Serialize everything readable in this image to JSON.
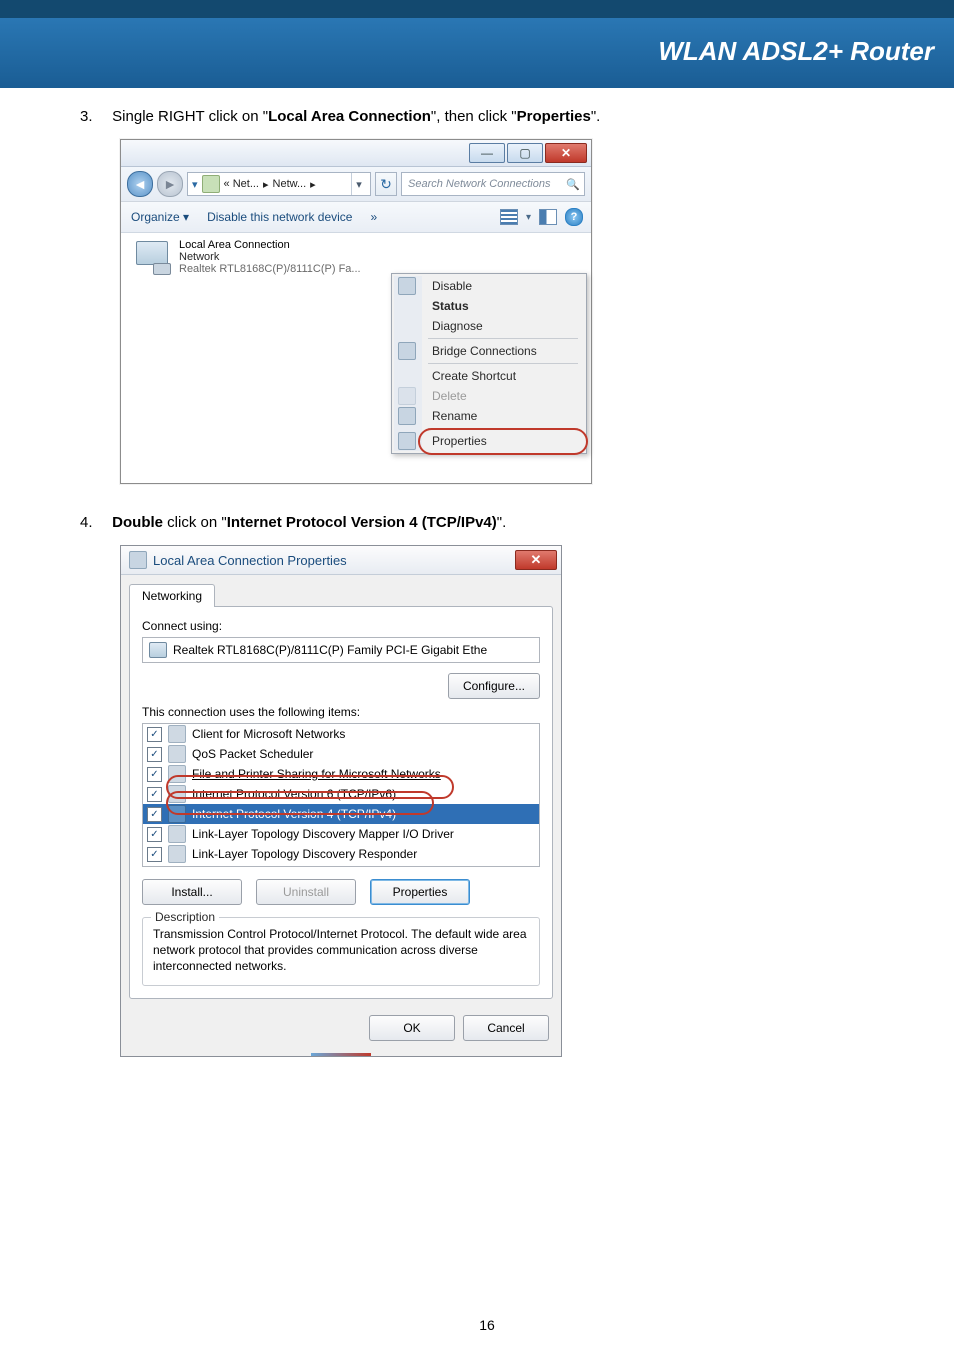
{
  "header": {
    "title": "WLAN ADSL2+ Router"
  },
  "steps": {
    "s3": {
      "num": "3.",
      "pre": "Single RIGHT click on \"",
      "bold1": "Local Area Connection",
      "mid": "\", then click \"",
      "bold2": "Properties",
      "post": "\"."
    },
    "s4": {
      "num": "4.",
      "boldA": "Double",
      "txt1": " click on \"",
      "boldB": "Internet Protocol Version 4 (TCP/IPv4)",
      "txt2": "\"."
    }
  },
  "win1": {
    "addr_part1": "«  Net...",
    "addr_sep": "▸",
    "addr_part2": "Netw...",
    "addr_sep2": "▸",
    "search_placeholder": "Search Network Connections",
    "toolbar": {
      "organize": "Organize ▾",
      "disable": "Disable this network device",
      "more": "»"
    },
    "conn": {
      "title": "Local Area Connection",
      "line2": "Network",
      "line3": "Realtek RTL8168C(P)/8111C(P) Fa..."
    },
    "menu": {
      "disable": "Disable",
      "status": "Status",
      "diagnose": "Diagnose",
      "bridge": "Bridge Connections",
      "shortcut": "Create Shortcut",
      "delete": "Delete",
      "rename": "Rename",
      "properties": "Properties"
    }
  },
  "dlg": {
    "title": "Local Area Connection Properties",
    "tab": "Networking",
    "connect_using": "Connect using:",
    "adapter": "Realtek RTL8168C(P)/8111C(P) Family PCI-E Gigabit Ethe",
    "configure": "Configure...",
    "uses": "This connection uses the following items:",
    "items": [
      "Client for Microsoft Networks",
      "QoS Packet Scheduler",
      "File and Printer Sharing for Microsoft Networks",
      "Internet Protocol Version 6 (TCP/IPv6)",
      "Internet Protocol Version 4 (TCP/IPv4)",
      "Link-Layer Topology Discovery Mapper I/O Driver",
      "Link-Layer Topology Discovery Responder"
    ],
    "install": "Install...",
    "uninstall": "Uninstall",
    "properties": "Properties",
    "desc_label": "Description",
    "desc": "Transmission Control Protocol/Internet Protocol. The default wide area network protocol that provides communication across diverse interconnected networks.",
    "ok": "OK",
    "cancel": "Cancel"
  },
  "pagenum": "16"
}
